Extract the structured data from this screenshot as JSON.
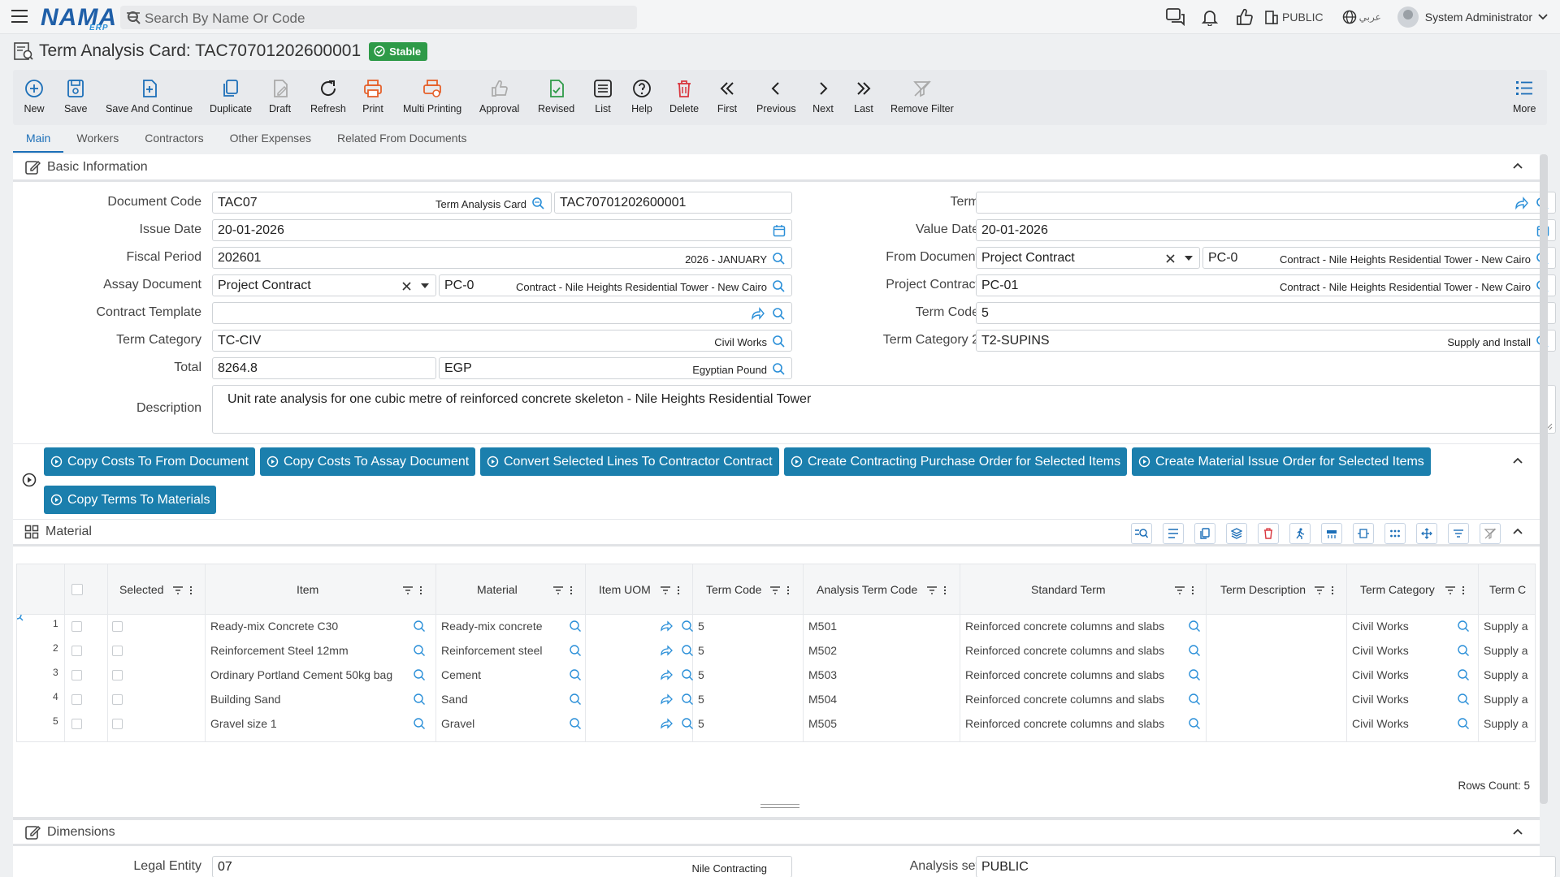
{
  "app": {
    "logo": "NAMA",
    "logo_sub": "ERP",
    "search_placeholder": "Search By Name Or Code",
    "org": "PUBLIC",
    "language": "عربي",
    "user": "System Administrator"
  },
  "page": {
    "title": "Term Analysis Card: TAC70701202600001",
    "status": "Stable"
  },
  "toolbar": [
    {
      "label": "New",
      "icon": "plus-circle-icon"
    },
    {
      "label": "Save",
      "icon": "save-icon"
    },
    {
      "label": "Save And Continue",
      "icon": "save-continue-icon"
    },
    {
      "label": "Duplicate",
      "icon": "duplicate-icon"
    },
    {
      "label": "Draft",
      "icon": "draft-icon"
    },
    {
      "label": "Refresh",
      "icon": "refresh-icon"
    },
    {
      "label": "Print",
      "icon": "print-icon"
    },
    {
      "label": "Multi Printing",
      "icon": "multi-print-icon"
    },
    {
      "label": "Approval",
      "icon": "thumbs-up-icon"
    },
    {
      "label": "Revised",
      "icon": "revised-icon"
    },
    {
      "label": "List",
      "icon": "list-icon"
    },
    {
      "label": "Help",
      "icon": "help-icon"
    },
    {
      "label": "Delete",
      "icon": "trash-icon"
    },
    {
      "label": "First",
      "icon": "first-icon"
    },
    {
      "label": "Previous",
      "icon": "previous-icon"
    },
    {
      "label": "Next",
      "icon": "next-icon"
    },
    {
      "label": "Last",
      "icon": "last-icon"
    },
    {
      "label": "Remove Filter",
      "icon": "remove-filter-icon"
    },
    {
      "label": "More",
      "icon": "more-icon"
    }
  ],
  "tabs": [
    "Main",
    "Workers",
    "Contractors",
    "Other Expenses",
    "Related From Documents"
  ],
  "basic": {
    "title": "Basic Information",
    "document_code": {
      "label": "Document Code",
      "code": "TAC07",
      "name": "Term Analysis Card",
      "number": "TAC70701202600001"
    },
    "issue_date": {
      "label": "Issue Date",
      "value": "20-01-2026"
    },
    "fiscal_period": {
      "label": "Fiscal Period",
      "value": "202601",
      "name": "2026 - JANUARY"
    },
    "assay_document": {
      "label": "Assay Document",
      "type": "Project Contract",
      "code": "PC-0",
      "name": "Contract - Nile Heights Residential Tower - New Cairo"
    },
    "contract_template": {
      "label": "Contract Template",
      "value": ""
    },
    "term_category": {
      "label": "Term Category",
      "value": "TC-CIV",
      "name": "Civil Works"
    },
    "total": {
      "label": "Total",
      "value": "8264.8",
      "currency": "EGP",
      "currency_name": "Egyptian Pound"
    },
    "term": {
      "label": "Term",
      "value": ""
    },
    "value_date": {
      "label": "Value Date",
      "value": "20-01-2026"
    },
    "from_document": {
      "label": "From Document",
      "type": "Project Contract",
      "code": "PC-0",
      "name": "Contract - Nile Heights Residential Tower - New Cairo"
    },
    "project_contract": {
      "label": "Project Contract",
      "value": "PC-01",
      "name": "Contract - Nile Heights Residential Tower - New Cairo"
    },
    "term_code": {
      "label": "Term Code",
      "value": "5"
    },
    "term_category2": {
      "label": "Term Category 2",
      "value": "T2-SUPINS",
      "name": "Supply and Install"
    },
    "description": {
      "label": "Description",
      "value": "Unit rate analysis for one cubic metre of reinforced concrete skeleton - Nile Heights Residential Tower"
    }
  },
  "actions": [
    "Copy Costs To From Document",
    "Copy Costs To Assay Document",
    "Convert Selected Lines To Contractor Contract",
    "Create Contracting Purchase Order for Selected Items",
    "Create Material Issue Order for Selected Items",
    "Copy Terms To Materials"
  ],
  "material": {
    "title": "Material",
    "columns": [
      "Selected",
      "Item",
      "Material",
      "Item UOM",
      "Term Code",
      "Analysis Term Code",
      "Standard Term",
      "Term Description",
      "Term Category",
      "Term C"
    ],
    "rows": [
      {
        "n": "1",
        "item": "Ready-mix Concrete C30",
        "material": "Ready-mix concrete",
        "term_code": "5",
        "analysis": "M501",
        "standard": "Reinforced concrete columns and slabs",
        "category": "Civil Works",
        "cat2": "Supply a"
      },
      {
        "n": "2",
        "item": "Reinforcement Steel 12mm",
        "material": "Reinforcement steel",
        "term_code": "5",
        "analysis": "M502",
        "standard": "Reinforced concrete columns and slabs",
        "category": "Civil Works",
        "cat2": "Supply a"
      },
      {
        "n": "3",
        "item": "Ordinary Portland Cement 50kg bag",
        "material": "Cement",
        "term_code": "5",
        "analysis": "M503",
        "standard": "Reinforced concrete columns and slabs",
        "category": "Civil Works",
        "cat2": "Supply a"
      },
      {
        "n": "4",
        "item": "Building Sand",
        "material": "Sand",
        "term_code": "5",
        "analysis": "M504",
        "standard": "Reinforced concrete columns and slabs",
        "category": "Civil Works",
        "cat2": "Supply a"
      },
      {
        "n": "5",
        "item": "Gravel size 1",
        "material": "Gravel",
        "term_code": "5",
        "analysis": "M505",
        "standard": "Reinforced concrete columns and slabs",
        "category": "Civil Works",
        "cat2": "Supply a"
      }
    ],
    "rows_count": "Rows Count: 5"
  },
  "dimensions": {
    "title": "Dimensions",
    "legal_entity": {
      "label": "Legal Entity",
      "value": "07",
      "name": "Nile Contracting"
    },
    "analysis_set": {
      "label": "Analysis set",
      "value": "PUBLIC"
    }
  },
  "colors": {
    "accent": "#1c6fb8",
    "action": "#1b7fad",
    "stable": "#2e9a48",
    "danger": "#d9363e",
    "orange": "#e5602a"
  }
}
